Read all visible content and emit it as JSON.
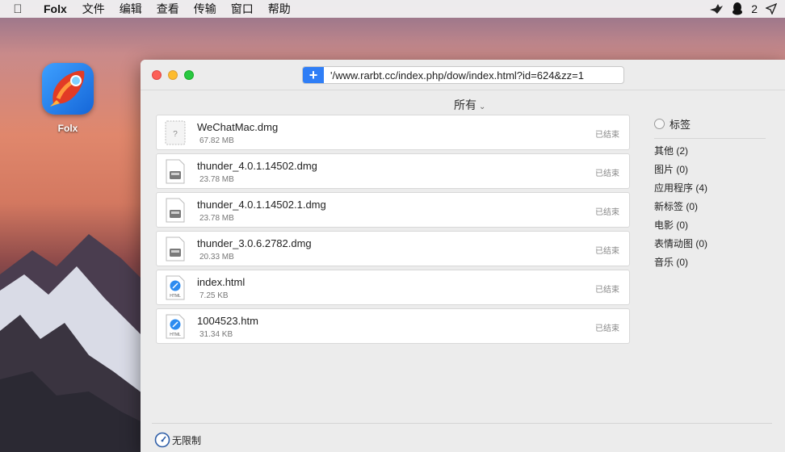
{
  "menubar": {
    "app_name": "Folx",
    "items": [
      "文件",
      "编辑",
      "查看",
      "传输",
      "窗口",
      "帮助"
    ],
    "qq_count": "2"
  },
  "desktop": {
    "icon_label": "Folx"
  },
  "window": {
    "url_value": "'/www.rarbt.cc/index.php/dow/index.html?id=624&zz=1",
    "add_label": "+",
    "filter_label": "所有"
  },
  "downloads": [
    {
      "name": "WeChatMac.dmg",
      "size": "67.82 MB",
      "status": "已结束",
      "icon": "unknown-file-icon"
    },
    {
      "name": "thunder_4.0.1.14502.dmg",
      "size": "23.78 MB",
      "status": "已结束",
      "icon": "disk-image-icon"
    },
    {
      "name": "thunder_4.0.1.14502.1.dmg",
      "size": "23.78 MB",
      "status": "已结束",
      "icon": "disk-image-icon"
    },
    {
      "name": "thunder_3.0.6.2782.dmg",
      "size": "20.33 MB",
      "status": "已结束",
      "icon": "disk-image-icon"
    },
    {
      "name": "index.html",
      "size": "7.25 KB",
      "status": "已结束",
      "icon": "html-file-icon"
    },
    {
      "name": "1004523.htm",
      "size": "31.34 KB",
      "status": "已结束",
      "icon": "html-file-icon"
    }
  ],
  "sidebar": {
    "title": "标签",
    "tags": [
      "其他 (2)",
      "图片 (0)",
      "应用程序 (4)",
      "新标签  (0)",
      "电影 (0)",
      "表情动图 (0)",
      "音乐 (0)"
    ]
  },
  "footer": {
    "speed_label": "无限制"
  },
  "colors": {
    "accent": "#2f7ef6",
    "close": "#fc5f57",
    "minimize": "#fdbc2e",
    "maximize": "#28c840"
  }
}
